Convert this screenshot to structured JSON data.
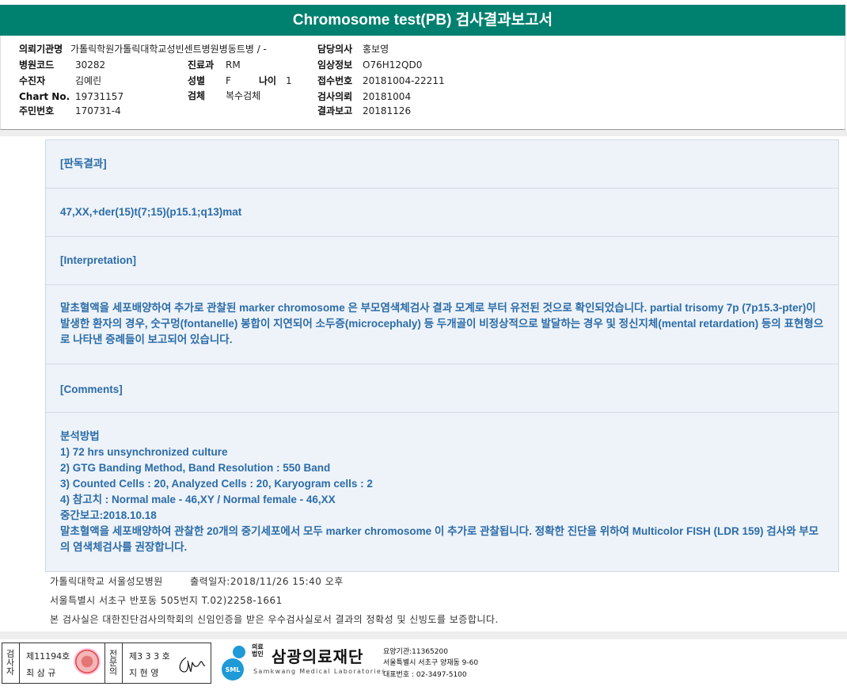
{
  "title": "Chromosome test(PB) 검사결과보고서",
  "header": {
    "institution_label": "의뢰기관명",
    "institution": "가톨릭학원가톨릭대학교성빈센트병원",
    "ward": "병동트병 / -",
    "hospital_code_label": "병원코드",
    "hospital_code": "30282",
    "department_label": "진료과",
    "department": "RM",
    "patient_label": "수진자",
    "patient": "김예린",
    "sex_label": "성별",
    "sex": "F",
    "age_label": "나이",
    "age": "1",
    "chart_label": "Chart No.",
    "chart": "19731157",
    "specimen_label": "검체",
    "specimen": "복수검체",
    "resident_label": "주민번호",
    "resident": "170731-4",
    "doctor_label": "담당의사",
    "doctor": "홍보영",
    "clinical_label": "임상정보",
    "clinical": "O76H12QD0",
    "receipt_label": "접수번호",
    "receipt": "20181004-22211",
    "request_label": "검사의뢰",
    "request": "20181004",
    "report_label": "결과보고",
    "report": "20181126"
  },
  "report": {
    "result_heading": "[판독결과]",
    "karyotype": "47,XX,+der(15)t(7;15)(p15.1;q13)mat",
    "interpretation_heading": "[Interpretation]",
    "interpretation": "말초혈액을 세포배양하여 추가로 관찰된 marker chromosome 은 부모염색체검사 결과 모계로 부터 유전된 것으로 확인되었습니다. partial trisomy 7p (7p15.3-pter)이 발생한 환자의 경우, 숫구멍(fontanelle) 봉합이 지연되어 소두증(microcephaly) 등 두개골이 비정상적으로 발달하는 경우 및 정신지체(mental retardation) 등의 표현형으로 나타낸 증례들이 보고되어 있습니다.",
    "comments_heading": "[Comments]",
    "comments": [
      "분석방법",
      "1) 72 hrs unsynchronized culture",
      "2) GTG Banding Method, Band Resolution : 550 Band",
      "3) Counted Cells : 20, Analyzed Cells : 20, Karyogram cells : 2",
      "4) 참고치 : Normal male - 46,XY / Normal female - 46,XX",
      "중간보고:2018.10.18"
    ],
    "comments_para": "말초혈액을 세포배양하여 관찰한 20개의 중기세포에서 모두 marker chromosome 이 추가로 관찰됩니다. 정확한 진단을 위하여 Multicolor FISH (LDR 159) 검사와 부모의 염색체검사를 권장합니다."
  },
  "footer": {
    "hospital": "가톨릭대학교 서울성모병원",
    "print_time": "출력일자:2018/11/26 15:40 오후",
    "address": "서울특별시 서초구 반포동 505번지 T.02)2258-1661",
    "notice": "본 검사실은 대한진단검사의학회의 신임인증을 받은 우수검사실로서 결과의 정확성 및 신빙도를 보증합니다."
  },
  "signature": {
    "inspector_vertical": "검사자",
    "inspector_no": "제11194호",
    "inspector_name": "최 삼 규",
    "confirm_vertical": "전문의",
    "doctor_no": "제3 3 3 호",
    "doctor_name": "지 현 영"
  },
  "lab": {
    "legal_tag": "의료\n법인",
    "name": "삼광의료재단",
    "english": "Samkwang Medical Laboratories",
    "logo_text": "SML",
    "code": "요양기관:11365200",
    "address": "서울특별시 서초구 양재동 9-60",
    "phone": "대표번호 : 02-3497-5100"
  },
  "colors": {
    "title_bar": "#00806f",
    "report_text": "#2b6ca8",
    "report_bg": "#eef3f9"
  }
}
